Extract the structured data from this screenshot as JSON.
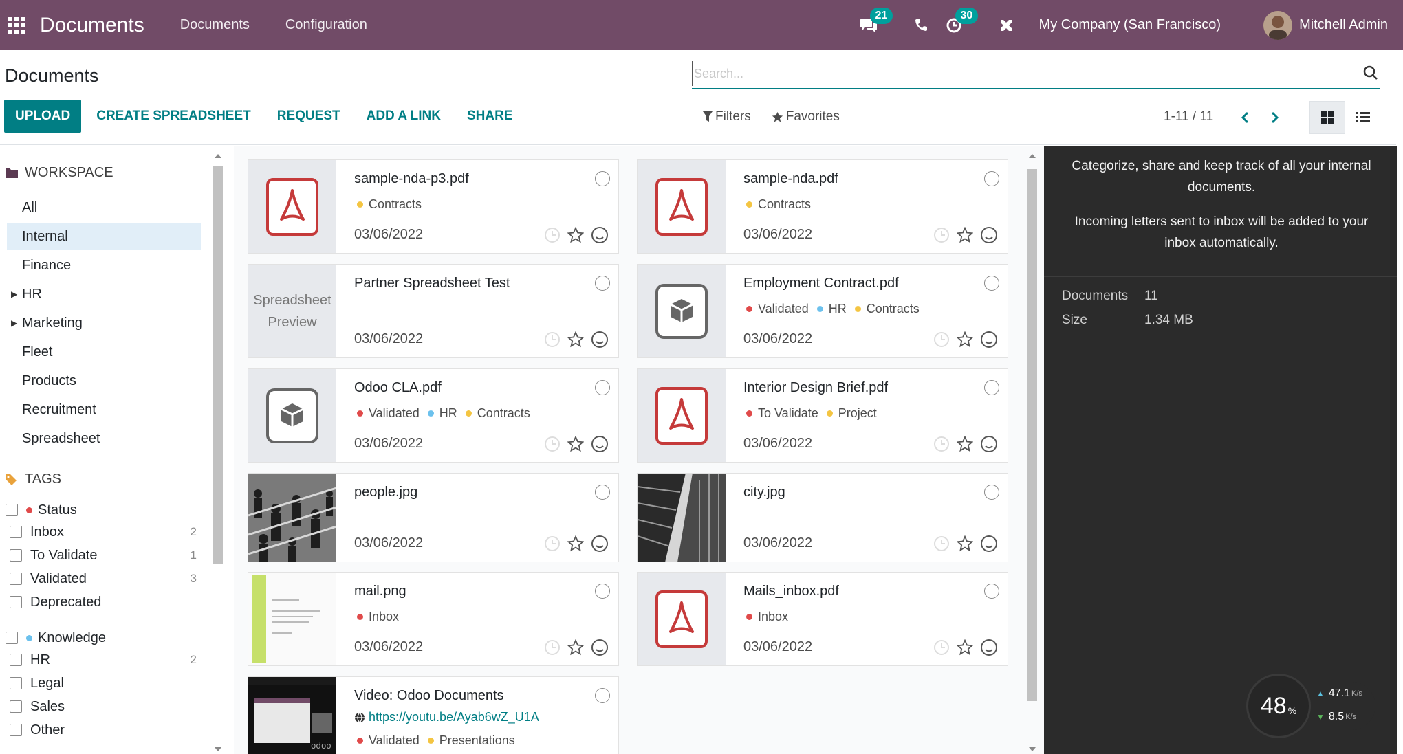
{
  "navbar": {
    "brand": "Documents",
    "menus": [
      "Documents",
      "Configuration"
    ],
    "chat_count": "21",
    "activity_count": "30",
    "company": "My Company (San Francisco)",
    "user": "Mitchell Admin"
  },
  "control_panel": {
    "title": "Documents",
    "search_placeholder": "Search...",
    "buttons": {
      "upload": "UPLOAD",
      "create_spreadsheet": "CREATE SPREADSHEET",
      "request": "REQUEST",
      "add_link": "ADD A LINK",
      "share": "SHARE"
    },
    "filters": "Filters",
    "favorites": "Favorites",
    "pager": "1-11 / 11"
  },
  "sidebar": {
    "workspace_header": "WORKSPACE",
    "workspaces": [
      "All",
      "Internal",
      "Finance",
      "HR",
      "Marketing",
      "Fleet",
      "Products",
      "Recruitment",
      "Spreadsheet"
    ],
    "active_workspace": "Internal",
    "tags_header": "TAGS",
    "tag_groups": [
      {
        "name": "Status",
        "color": "#e04a4a",
        "tags": [
          {
            "name": "Inbox",
            "count": "2"
          },
          {
            "name": "To Validate",
            "count": "1"
          },
          {
            "name": "Validated",
            "count": "3"
          },
          {
            "name": "Deprecated",
            "count": ""
          }
        ]
      },
      {
        "name": "Knowledge",
        "color": "#6cc1ed",
        "tags": [
          {
            "name": "HR",
            "count": "2"
          },
          {
            "name": "Legal",
            "count": ""
          },
          {
            "name": "Sales",
            "count": ""
          },
          {
            "name": "Other",
            "count": ""
          }
        ]
      }
    ]
  },
  "tag_colors": {
    "red": "#e04a4a",
    "blue": "#6cc1ed",
    "yellow": "#f4c542"
  },
  "documents": [
    {
      "name": "sample-nda-p3.pdf",
      "thumb": "pdf-icon",
      "tags": [
        {
          "label": "Contracts",
          "color": "#f4c542"
        }
      ],
      "date": "03/06/2022"
    },
    {
      "name": "sample-nda.pdf",
      "thumb": "pdf-icon",
      "tags": [
        {
          "label": "Contracts",
          "color": "#f4c542"
        }
      ],
      "date": "03/06/2022"
    },
    {
      "name": "Partner Spreadsheet Test",
      "thumb": "spreadsheet-preview",
      "thumb_text": [
        "Spreadsheet",
        "Preview"
      ],
      "tags": [],
      "date": "03/06/2022"
    },
    {
      "name": "Employment Contract.pdf",
      "thumb": "box-icon",
      "tags": [
        {
          "label": "Validated",
          "color": "#e04a4a"
        },
        {
          "label": "HR",
          "color": "#6cc1ed"
        },
        {
          "label": "Contracts",
          "color": "#f4c542"
        }
      ],
      "date": "03/06/2022"
    },
    {
      "name": "Odoo CLA.pdf",
      "thumb": "box-icon",
      "tags": [
        {
          "label": "Validated",
          "color": "#e04a4a"
        },
        {
          "label": "HR",
          "color": "#6cc1ed"
        },
        {
          "label": "Contracts",
          "color": "#f4c542"
        }
      ],
      "date": "03/06/2022"
    },
    {
      "name": "Interior Design Brief.pdf",
      "thumb": "pdf-icon",
      "tags": [
        {
          "label": "To Validate",
          "color": "#e04a4a"
        },
        {
          "label": "Project",
          "color": "#f4c542"
        }
      ],
      "date": "03/06/2022"
    },
    {
      "name": "people.jpg",
      "thumb": "photo-people",
      "tags": [],
      "date": "03/06/2022"
    },
    {
      "name": "city.jpg",
      "thumb": "photo-city",
      "tags": [],
      "date": "03/06/2022"
    },
    {
      "name": "mail.png",
      "thumb": "image-mail",
      "tags": [
        {
          "label": "Inbox",
          "color": "#e04a4a"
        }
      ],
      "date": "03/06/2022"
    },
    {
      "name": "Mails_inbox.pdf",
      "thumb": "pdf-icon",
      "tags": [
        {
          "label": "Inbox",
          "color": "#e04a4a"
        }
      ],
      "date": "03/06/2022"
    },
    {
      "name": "Video: Odoo Documents",
      "thumb": "video",
      "thumb_text": [
        "odoo"
      ],
      "url": "https://youtu.be/Ayab6wZ_U1A",
      "tags": [
        {
          "label": "Validated",
          "color": "#e04a4a"
        },
        {
          "label": "Presentations",
          "color": "#f4c542"
        }
      ],
      "date": ""
    }
  ],
  "info_panel": {
    "help_1": "Categorize, share and keep track of all your internal documents.",
    "help_2": "Incoming letters sent to inbox will be added to your inbox automatically.",
    "documents_label": "Documents",
    "documents_value": "11",
    "size_label": "Size",
    "size_value": "1.34 MB"
  },
  "overlay": {
    "percent": "48",
    "percent_unit": "%",
    "upload": "47.1",
    "download": "8.5",
    "rate_unit": "K/s"
  }
}
